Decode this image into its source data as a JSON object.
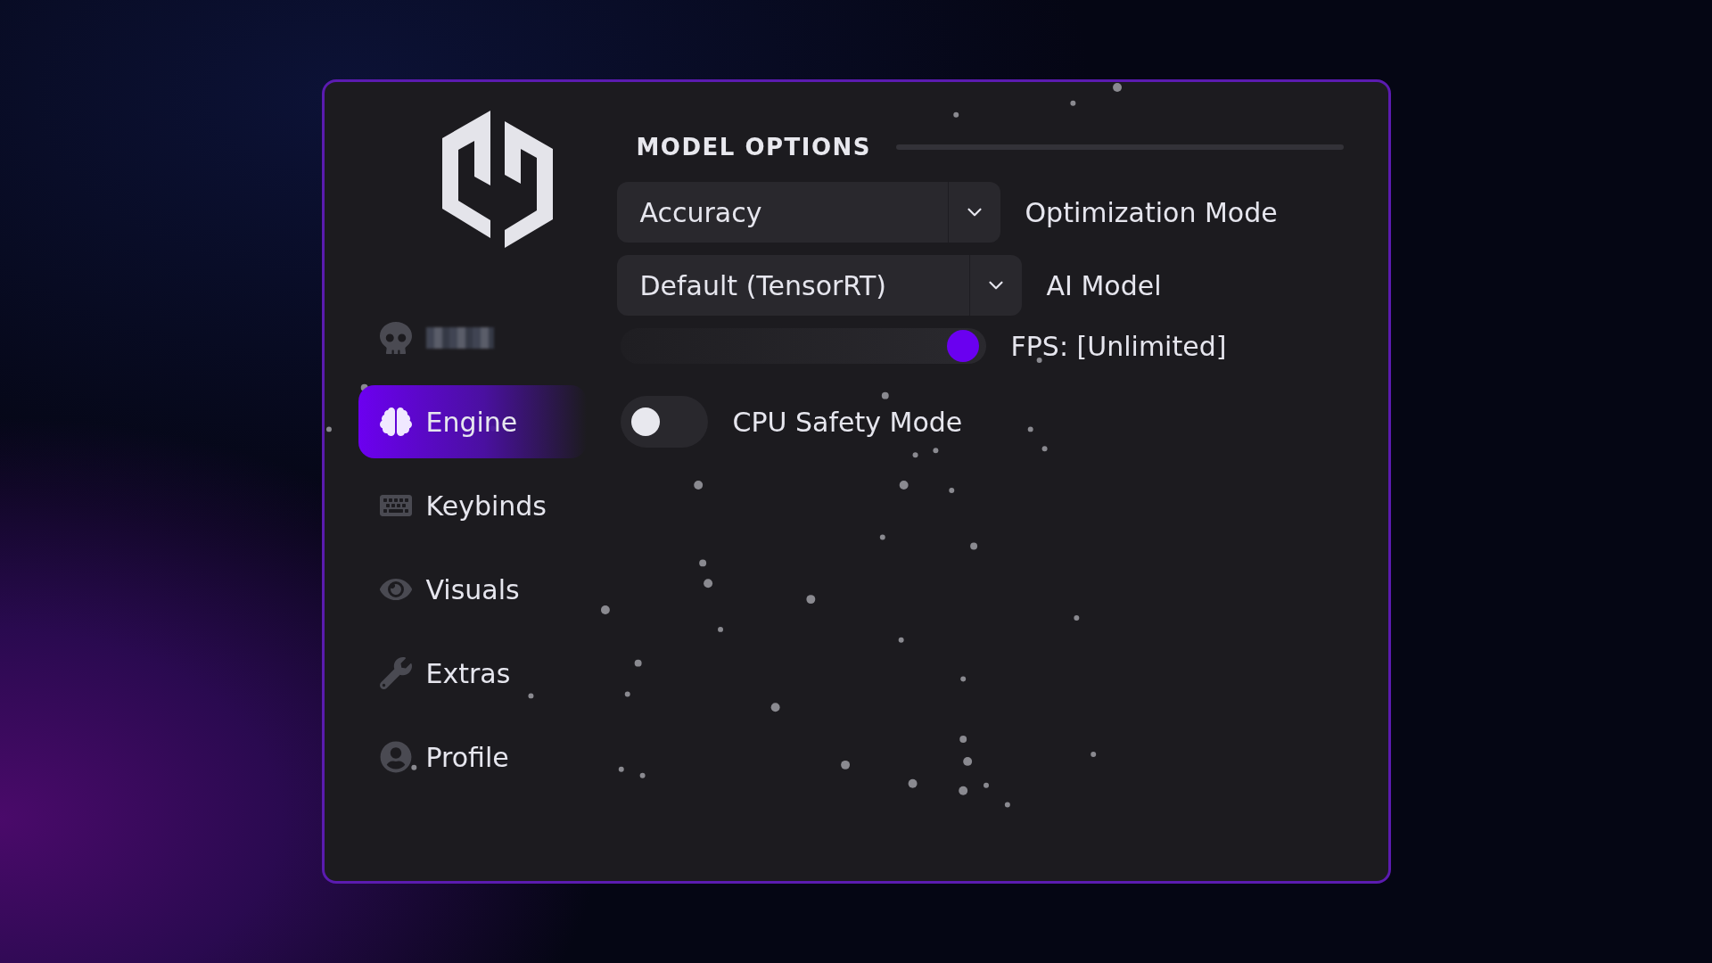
{
  "sidebar": {
    "items": [
      {
        "label": "Engine",
        "selected": true
      },
      {
        "label": "Keybinds",
        "selected": false
      },
      {
        "label": "Visuals",
        "selected": false
      },
      {
        "label": "Extras",
        "selected": false
      },
      {
        "label": "Profile",
        "selected": false
      }
    ]
  },
  "section": {
    "title": "MODEL OPTIONS"
  },
  "controls": [
    {
      "kind": "dropdown",
      "value": "Accuracy",
      "label": "Optimization Mode"
    },
    {
      "kind": "dropdown",
      "value": "Default (TensorRT)",
      "label": "AI Model"
    },
    {
      "kind": "slider",
      "level": 1,
      "label": "FPS: [Unlimited]"
    },
    {
      "kind": "toggle",
      "on": false,
      "label": "CPU Safety Mode"
    }
  ]
}
